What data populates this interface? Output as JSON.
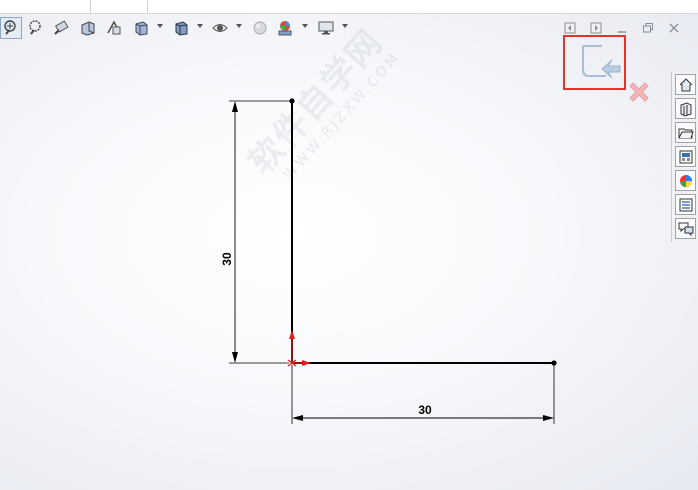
{
  "toolbar": {
    "items": [
      {
        "name": "zoom-to-fit-icon"
      },
      {
        "name": "zoom-to-area-icon"
      },
      {
        "name": "previous-view-icon"
      },
      {
        "name": "section-view-icon"
      },
      {
        "name": "dynamic-annotation-views-icon"
      },
      {
        "name": "view-orientation-icon",
        "dropdown": true
      },
      {
        "name": "display-style-icon",
        "dropdown": true
      },
      {
        "name": "hide-show-items-icon",
        "dropdown": true
      },
      {
        "name": "edit-appearance-icon"
      },
      {
        "name": "apply-scene-icon",
        "dropdown": true
      },
      {
        "name": "view-settings-icon",
        "dropdown": true
      }
    ]
  },
  "window_controls": [
    "previous-icon",
    "next-icon",
    "minimize-icon",
    "restore-icon",
    "close-icon"
  ],
  "confirmation_corner": {
    "exit_sketch": "exit-sketch-icon",
    "cancel": "cancel-sketch-icon",
    "highlight_color": "#e0342f"
  },
  "task_pane": [
    "home-icon",
    "design-library-icon",
    "file-explorer-icon",
    "view-palette-icon",
    "appearances-icon",
    "custom-properties-icon",
    "forum-icon"
  ],
  "sketch": {
    "vertical_dimension": "30",
    "horizontal_dimension": "30",
    "line_color": "#000000",
    "origin_color": "#e81c1c"
  },
  "watermark": {
    "main": "软件自学网",
    "sub": "WWW.RJZXW.COM"
  }
}
